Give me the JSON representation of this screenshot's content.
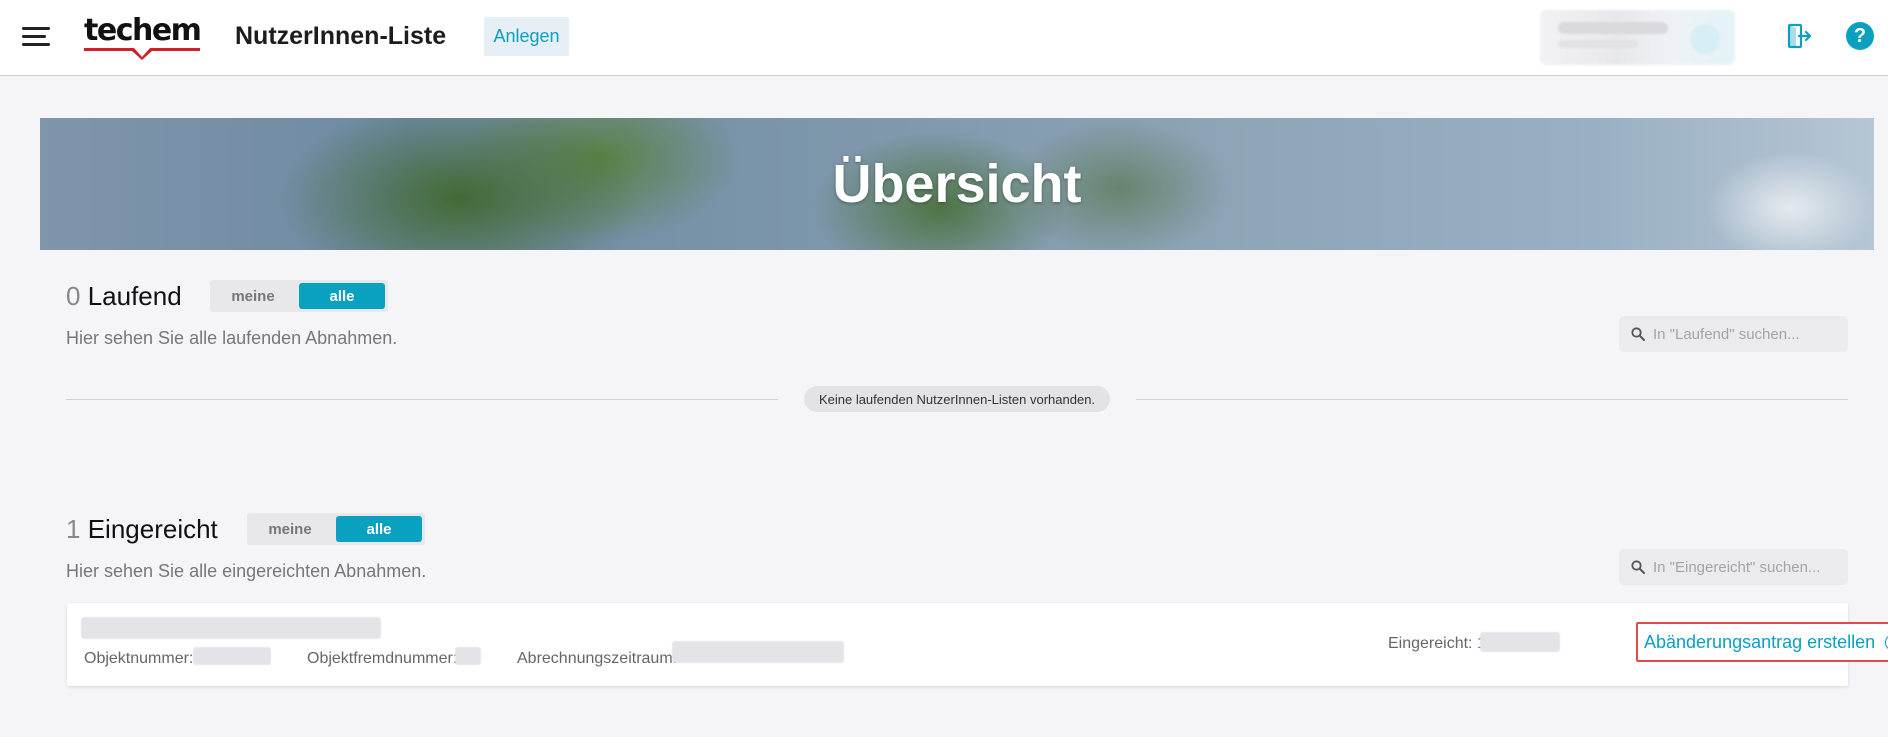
{
  "header": {
    "logo_text": "techem",
    "app_title": "NutzerInnen-Liste",
    "create_label": "Anlegen",
    "help_label": "?"
  },
  "banner": {
    "title": "Übersicht"
  },
  "running": {
    "count": "0",
    "title": "Laufend",
    "toggle": {
      "mine": "meine",
      "all": "alle",
      "selected": "alle"
    },
    "description": "Hier sehen Sie alle laufenden Abnahmen.",
    "search_placeholder": "In \"Laufend\" suchen...",
    "empty_message": "Keine laufenden NutzerInnen-Listen vorhanden."
  },
  "submitted": {
    "count": "1",
    "title": "Eingereicht",
    "toggle": {
      "mine": "meine",
      "all": "alle",
      "selected": "alle"
    },
    "description": "Hier sehen Sie alle eingereichten Abnahmen.",
    "search_placeholder": "In \"Eingereicht\" suchen...",
    "items": [
      {
        "object_number_label": "Objektnummer:",
        "foreign_number_label": "Objektfremdnummer:",
        "period_label": "Abrechnungszeitraum:",
        "submitted_label": "Eingereicht:",
        "submitted_value_prefix": "1",
        "action_label": "Abänderungsantrag erstellen"
      }
    ]
  },
  "colors": {
    "accent": "#0aa0c0",
    "highlight_border": "#e24b4b",
    "background": "#f5f4f7"
  },
  "icons": [
    "hamburger-icon",
    "logout-icon",
    "help-icon",
    "search-icon",
    "info-icon"
  ]
}
